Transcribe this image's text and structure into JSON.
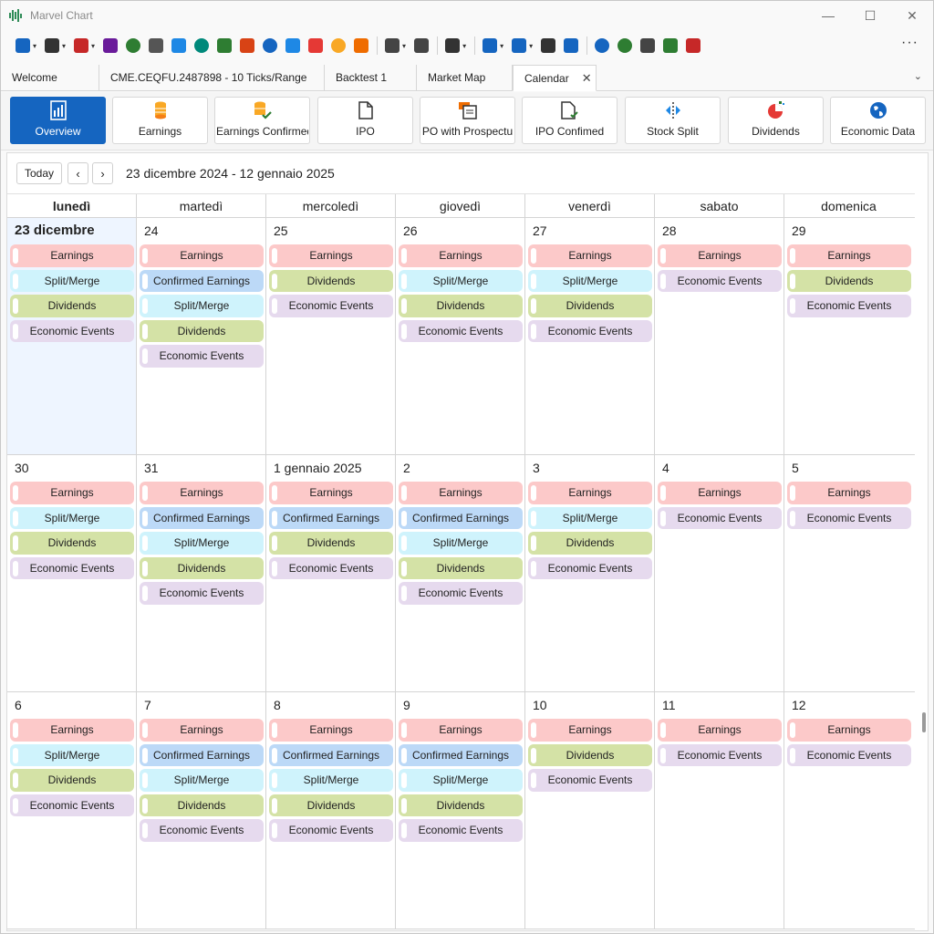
{
  "app": {
    "title": "Marvel Chart"
  },
  "window_controls": [
    "—",
    "☐",
    "✕"
  ],
  "toolbar": {
    "icons": [
      {
        "name": "network-icon",
        "color": "#1565c0",
        "caret": true
      },
      {
        "name": "monitor-icon",
        "color": "#333333",
        "caret": true
      },
      {
        "name": "candlestick-icon",
        "color": "#c62828",
        "caret": true
      },
      {
        "name": "bars-icon",
        "color": "#6a1b9a",
        "caret": false
      },
      {
        "name": "history-icon",
        "color": "#2e7d32",
        "caret": false
      },
      {
        "name": "document-icon",
        "color": "#555555",
        "caret": false
      },
      {
        "name": "crosshair-icon",
        "color": "#1e88e5",
        "caret": false
      },
      {
        "name": "pie-icon",
        "color": "#00897b",
        "caret": false
      },
      {
        "name": "dollar-icon",
        "color": "#2e7d32",
        "caret": false
      },
      {
        "name": "calendar-icon",
        "color": "#d84315",
        "caret": false
      },
      {
        "name": "globe-icon",
        "color": "#1565c0",
        "caret": false
      },
      {
        "name": "search-chart-icon",
        "color": "#1e88e5",
        "caret": false
      },
      {
        "name": "heatmap-icon",
        "color": "#e53935",
        "caret": false
      },
      {
        "name": "coins-icon",
        "color": "#f9a825",
        "caret": false
      },
      {
        "name": "user-dollar-icon",
        "color": "#ef6c00",
        "caret": false
      },
      {
        "name": "separator",
        "color": "",
        "caret": false
      },
      {
        "name": "layout-icon",
        "color": "#444444",
        "caret": true
      },
      {
        "name": "bug-icon",
        "color": "#444444",
        "caret": false
      },
      {
        "name": "separator",
        "color": "",
        "caret": false
      },
      {
        "name": "tools-icon",
        "color": "#333333",
        "caret": true
      },
      {
        "name": "separator",
        "color": "",
        "caret": false
      },
      {
        "name": "color-bar-icon",
        "color": "#1565c0",
        "caret": true
      },
      {
        "name": "font-icon",
        "color": "#1565c0",
        "caret": true
      },
      {
        "name": "keyboard-icon",
        "color": "#333333",
        "caret": false
      },
      {
        "name": "settings-icon",
        "color": "#1565c0",
        "caret": false
      },
      {
        "name": "separator",
        "color": "",
        "caret": false
      },
      {
        "name": "info-icon",
        "color": "#1565c0",
        "caret": false
      },
      {
        "name": "help-icon",
        "color": "#2e7d32",
        "caret": false
      },
      {
        "name": "copy-icon",
        "color": "#444444",
        "caret": false
      },
      {
        "name": "wave-icon",
        "color": "#2e7d32",
        "caret": false
      },
      {
        "name": "app-badge-icon",
        "color": "#c62828",
        "caret": false
      }
    ],
    "more_label": "···"
  },
  "tabs": [
    {
      "label": "Welcome",
      "width": 108,
      "active": false,
      "closable": false
    },
    {
      "label": "CME.CEQFU.2487898 - 10 Ticks/Range",
      "width": 247,
      "active": false,
      "closable": false
    },
    {
      "label": "Backtest 1",
      "width": 101,
      "active": false,
      "closable": false
    },
    {
      "label": "Market Map",
      "width": 105,
      "active": false,
      "closable": false
    },
    {
      "label": "Calendar",
      "width": 92,
      "active": true,
      "closable": true
    }
  ],
  "tab_close_glyph": "✕",
  "tab_overflow_glyph": "⌄",
  "ribbon": [
    {
      "label": "Overview",
      "icon": "overview-icon",
      "active": true
    },
    {
      "label": "Earnings",
      "icon": "coins-icon",
      "active": false
    },
    {
      "label": "Earnings Confirmed",
      "icon": "coins-check-icon",
      "active": false
    },
    {
      "label": "IPO",
      "icon": "document-icon",
      "active": false
    },
    {
      "label": "PO with Prospectu",
      "icon": "prospectus-icon",
      "active": false
    },
    {
      "label": "IPO Confimed",
      "icon": "document-check-icon",
      "active": false
    },
    {
      "label": "Stock Split",
      "icon": "split-icon",
      "active": false
    },
    {
      "label": "Dividends",
      "icon": "pie-icon",
      "active": false
    },
    {
      "label": "Economic Data",
      "icon": "globe-icon",
      "active": false
    }
  ],
  "calendar": {
    "today_label": "Today",
    "prev_glyph": "‹",
    "next_glyph": "›",
    "range_label": "23 dicembre 2024 - 12 gennaio 2025",
    "weekdays": [
      "lunedì",
      "martedì",
      "mercoledì",
      "giovedì",
      "venerdì",
      "sabato",
      "domenica"
    ],
    "event_colors": {
      "Earnings": "#fcc9c9",
      "Confirmed Earnings": "#bcd9f7",
      "Split/Merge": "#cff3fc",
      "Dividends": "#d4e2a6",
      "Economic Events": "#e6daee"
    },
    "weeks": [
      [
        {
          "label": "23 dicembre",
          "today": true,
          "events": [
            "Earnings",
            "Split/Merge",
            "Dividends",
            "Economic Events"
          ]
        },
        {
          "label": "24",
          "events": [
            "Earnings",
            "Confirmed Earnings",
            "Split/Merge",
            "Dividends",
            "Economic Events"
          ]
        },
        {
          "label": "25",
          "events": [
            "Earnings",
            "Dividends",
            "Economic Events"
          ]
        },
        {
          "label": "26",
          "events": [
            "Earnings",
            "Split/Merge",
            "Dividends",
            "Economic Events"
          ]
        },
        {
          "label": "27",
          "events": [
            "Earnings",
            "Split/Merge",
            "Dividends",
            "Economic Events"
          ]
        },
        {
          "label": "28",
          "events": [
            "Earnings",
            "Economic Events"
          ]
        },
        {
          "label": "29",
          "events": [
            "Earnings",
            "Dividends",
            "Economic Events"
          ]
        }
      ],
      [
        {
          "label": "30",
          "events": [
            "Earnings",
            "Split/Merge",
            "Dividends",
            "Economic Events"
          ]
        },
        {
          "label": "31",
          "events": [
            "Earnings",
            "Confirmed Earnings",
            "Split/Merge",
            "Dividends",
            "Economic Events"
          ]
        },
        {
          "label": "1 gennaio 2025",
          "events": [
            "Earnings",
            "Confirmed Earnings",
            "Dividends",
            "Economic Events"
          ]
        },
        {
          "label": "2",
          "events": [
            "Earnings",
            "Confirmed Earnings",
            "Split/Merge",
            "Dividends",
            "Economic Events"
          ]
        },
        {
          "label": "3",
          "events": [
            "Earnings",
            "Split/Merge",
            "Dividends",
            "Economic Events"
          ]
        },
        {
          "label": "4",
          "events": [
            "Earnings",
            "Economic Events"
          ]
        },
        {
          "label": "5",
          "events": [
            "Earnings",
            "Economic Events"
          ]
        }
      ],
      [
        {
          "label": "6",
          "events": [
            "Earnings",
            "Split/Merge",
            "Dividends",
            "Economic Events"
          ]
        },
        {
          "label": "7",
          "events": [
            "Earnings",
            "Confirmed Earnings",
            "Split/Merge",
            "Dividends",
            "Economic Events"
          ]
        },
        {
          "label": "8",
          "events": [
            "Earnings",
            "Confirmed Earnings",
            "Split/Merge",
            "Dividends",
            "Economic Events"
          ]
        },
        {
          "label": "9",
          "events": [
            "Earnings",
            "Confirmed Earnings",
            "Split/Merge",
            "Dividends",
            "Economic Events"
          ]
        },
        {
          "label": "10",
          "events": [
            "Earnings",
            "Dividends",
            "Economic Events"
          ]
        },
        {
          "label": "11",
          "events": [
            "Earnings",
            "Economic Events"
          ]
        },
        {
          "label": "12",
          "events": [
            "Earnings",
            "Economic Events"
          ]
        }
      ]
    ]
  }
}
